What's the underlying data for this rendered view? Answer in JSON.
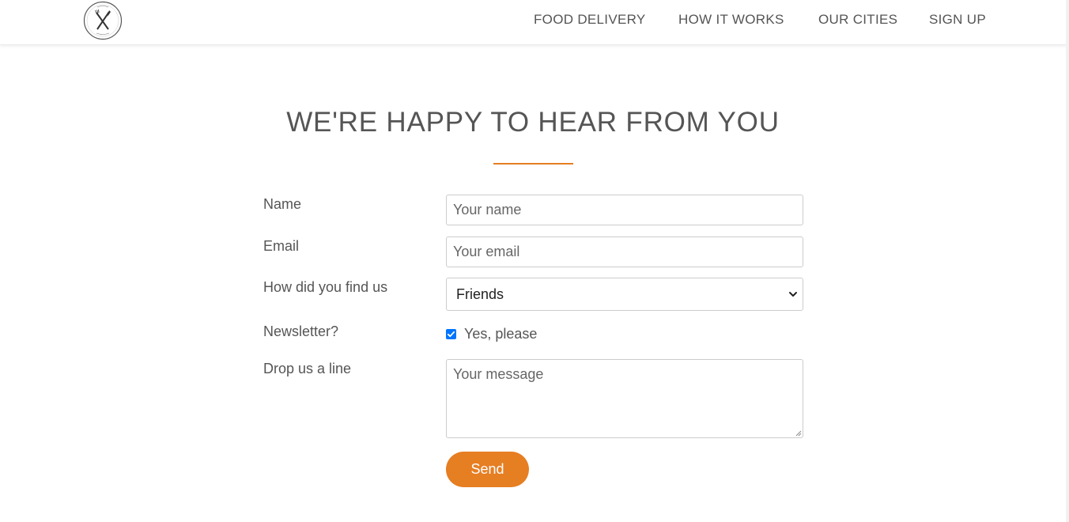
{
  "header": {
    "logo_icon": "fork-knife-icon",
    "nav": [
      {
        "label": "FOOD DELIVERY"
      },
      {
        "label": "HOW IT WORKS"
      },
      {
        "label": "OUR CITIES"
      },
      {
        "label": "SIGN UP"
      }
    ]
  },
  "main": {
    "title": "WE'RE HAPPY TO HEAR FROM YOU",
    "accent_color": "#e67e22"
  },
  "form": {
    "name": {
      "label": "Name",
      "placeholder": "Your name",
      "value": ""
    },
    "email": {
      "label": "Email",
      "placeholder": "Your email",
      "value": ""
    },
    "find_us": {
      "label": "How did you find us",
      "selected": "Friends"
    },
    "newsletter": {
      "label": "Newsletter?",
      "checkbox_label": "Yes, please",
      "checked": true
    },
    "message": {
      "label": "Drop us a line",
      "placeholder": "Your message",
      "value": ""
    },
    "submit_label": "Send"
  }
}
